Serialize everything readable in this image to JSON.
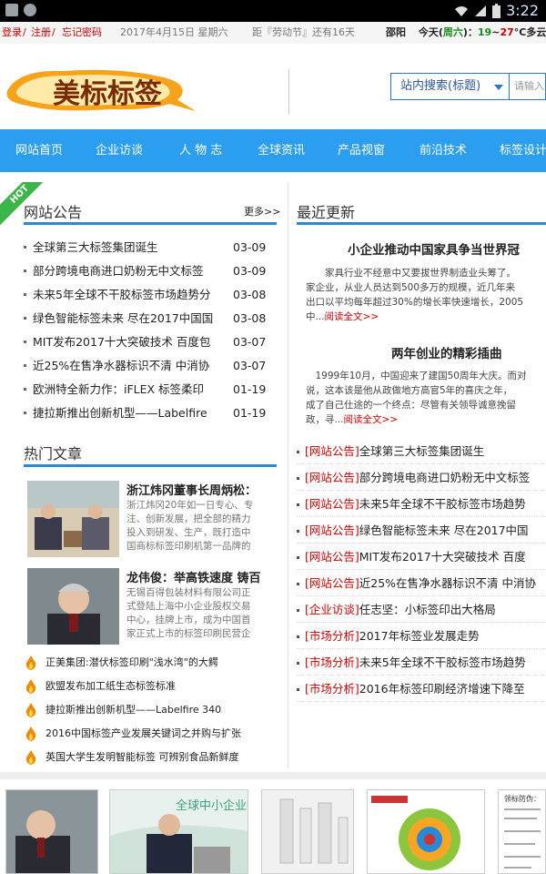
{
  "status_bar": {
    "time": "3:22"
  },
  "topbar": {
    "login": "登录",
    "sep1": " / ",
    "register": "注册",
    "sep2": " / ",
    "forgot": "忘记密码",
    "date": "2017年4月15日 星期六",
    "countdown": "距『劳动节』还有16天",
    "city": "邵阳",
    "weather_prefix": "今天(",
    "weekday": "周六",
    "weather_mid": ")：",
    "temp_low": "19",
    "temp_sep": "~",
    "temp_high": "27",
    "weather_desc": "°C多云"
  },
  "header": {
    "logo_text": "美标标签",
    "search_scope": "站内搜索(标题)",
    "search_placeholder": "请输入"
  },
  "nav": {
    "items": [
      "网站首页",
      "企业访谈",
      "人 物 志",
      "全球资讯",
      "产品视窗",
      "前沿技术",
      "标签设计"
    ]
  },
  "notices": {
    "badge": "HOT",
    "title": "网站公告",
    "more": "更多>>",
    "items": [
      {
        "title": "全球第三大标签集团诞生",
        "date": "03-09"
      },
      {
        "title": "部分跨境电商进口奶粉无中文标签",
        "date": "03-09"
      },
      {
        "title": "未来5年全球不干胶标签市场趋势分",
        "date": "03-08"
      },
      {
        "title": "绿色智能标签未来 尽在2017中国国",
        "date": "03-08"
      },
      {
        "title": "MIT发布2017十大突破技术 百度包",
        "date": "03-07"
      },
      {
        "title": "近25%在售净水器标识不清 中消协",
        "date": "03-07"
      },
      {
        "title": "欧洲特全新力作：iFLEX 标签柔印",
        "date": "01-19"
      },
      {
        "title": "捷拉斯推出创新机型——Labelfire",
        "date": "01-19"
      }
    ]
  },
  "hot_articles": {
    "title": "热门文章",
    "featured": [
      {
        "title": "浙江炜冈董事长周炳松：",
        "lines": [
          "浙江炜冈20年如一日专心、专",
          "注、创新发展，把全部的精力",
          "投入到研发、生产，既打造中",
          "国商标标签印刷机第一品牌的"
        ]
      },
      {
        "title": "龙伟俊：举高铁速度 铸百",
        "lines": [
          "无锡百得包装材料有限公司正",
          "式登陆上海中小企业股权交易",
          "中心，挂牌上市，成为中国首",
          "家正式上市的标签印刷民营企"
        ]
      }
    ],
    "list": [
      "正美集团:潜伏标签印刷\"浅水湾\"的大鳄",
      "欧盟发布加工纸生态标签标准",
      "捷拉斯推出创新机型——Labelfire 340",
      "2016中国标签产业发展关键词之并购与扩张",
      "英国大学生发明智能标签 可辨别食品新鲜度"
    ]
  },
  "recent": {
    "title": "最近更新",
    "features": [
      {
        "title": "小企业推动中国家具争当世界冠",
        "lines": [
          "　　家具行业不经意中又要拔世界制造业头筹了。",
          "家企业，从业人员达到500多万的规模，近几年来",
          "出口以平均每年超过30%的增长率快速增长，2005",
          "中..."
        ],
        "more": "阅读全文>>"
      },
      {
        "title": "两年创业的精彩插曲",
        "lines": [
          "　1999年10月，中国迎来了建国50周年大庆。而对",
          "说，这本该是他从政做地方高官5年的喜庆之年，",
          "成了自己仕途的一个终点：尽管有关领导诚意挽留",
          "政，寻..."
        ],
        "more": "阅读全文>>"
      }
    ],
    "links": [
      {
        "tag": "[网站公告]",
        "title": "全球第三大标签集团诞生"
      },
      {
        "tag": "[网站公告]",
        "title": "部分跨境电商进口奶粉无中文标签"
      },
      {
        "tag": "[网站公告]",
        "title": "未来5年全球不干胶标签市场趋势"
      },
      {
        "tag": "[网站公告]",
        "title": "绿色智能标签未来 尽在2017中国"
      },
      {
        "tag": "[网站公告]",
        "title": "MIT发布2017十大突破技术 百度"
      },
      {
        "tag": "[网站公告]",
        "title": "近25%在售净水器标识不清 中消协"
      },
      {
        "tag": "[企业访谈]",
        "title": "任志坚：小标签印出大格局"
      },
      {
        "tag": "[市场分析]",
        "title": "2017年标签业发展走势"
      },
      {
        "tag": "[市场分析]",
        "title": "未来5年全球不干胶标签市场趋势"
      },
      {
        "tag": "[市场分析]",
        "title": "2016年标签印刷经济增速下降至"
      }
    ]
  },
  "gallery": {
    "summit_text": "全球中小企业峰会",
    "doc_heading": "领标防伪："
  },
  "colors": {
    "nav": "#2b9ef0",
    "accent_red": "#cc0000",
    "hot_green": "#3cb54a",
    "underline_blue": "#2a89d6"
  }
}
